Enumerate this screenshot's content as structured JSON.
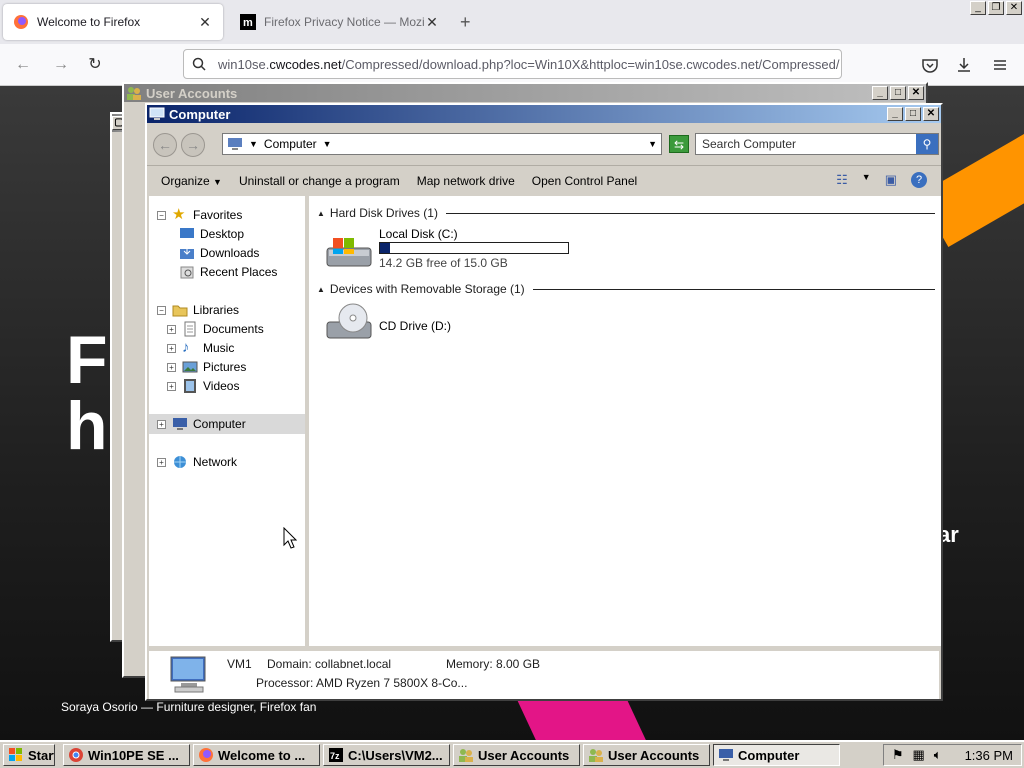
{
  "browser": {
    "tabs": [
      {
        "title": "Welcome to Firefox",
        "active": true
      },
      {
        "title": "Firefox Privacy Notice — Mozilla",
        "active": false
      }
    ],
    "url_prefix": "win10se.",
    "url_domain": "cwcodes.net",
    "url_rest": "/Compressed/download.php?loc=Win10X&httploc=win10se.cwcodes.net/Compressed/"
  },
  "page": {
    "big_text_1": "Fi",
    "big_text_2": "h",
    "side_text": "ar",
    "caption": "Soraya Osorio — Furniture designer, Firefox fan"
  },
  "user_accounts_window": {
    "title": "User Accounts"
  },
  "explorer": {
    "title": "Computer",
    "address": "Computer",
    "search_placeholder": "Search Computer",
    "toolbar": [
      "Organize",
      "Uninstall or change a program",
      "Map network drive",
      "Open Control Panel"
    ],
    "tree": {
      "favorites": "Favorites",
      "desktop": "Desktop",
      "downloads": "Downloads",
      "recent": "Recent Places",
      "libraries": "Libraries",
      "documents": "Documents",
      "music": "Music",
      "pictures": "Pictures",
      "videos": "Videos",
      "computer": "Computer",
      "network": "Network"
    },
    "groups": {
      "hdd": "Hard Disk Drives (1)",
      "removable": "Devices with Removable Storage (1)"
    },
    "drives": {
      "c_name": "Local Disk (C:)",
      "c_free": "14.2 GB free of 15.0 GB",
      "c_used_fraction": 0.053,
      "d_name": "CD Drive (D:)"
    },
    "details": {
      "name": "VM1",
      "domain": "Domain: collabnet.local",
      "memory": "Memory: 8.00 GB",
      "processor": "Processor: AMD Ryzen 7 5800X 8-Co..."
    }
  },
  "taskbar": {
    "start": "Start",
    "items": [
      "Win10PE SE ...",
      "Welcome to ...",
      "C:\\Users\\VM2...",
      "User Accounts",
      "User Accounts",
      "Computer"
    ],
    "clock": "1:36 PM"
  },
  "colors": {
    "titlebar_active": "#0a246a",
    "titlebar_inactive": "#808080",
    "firefox_orange": "#ff9400",
    "firefox_pink": "#e31587"
  }
}
